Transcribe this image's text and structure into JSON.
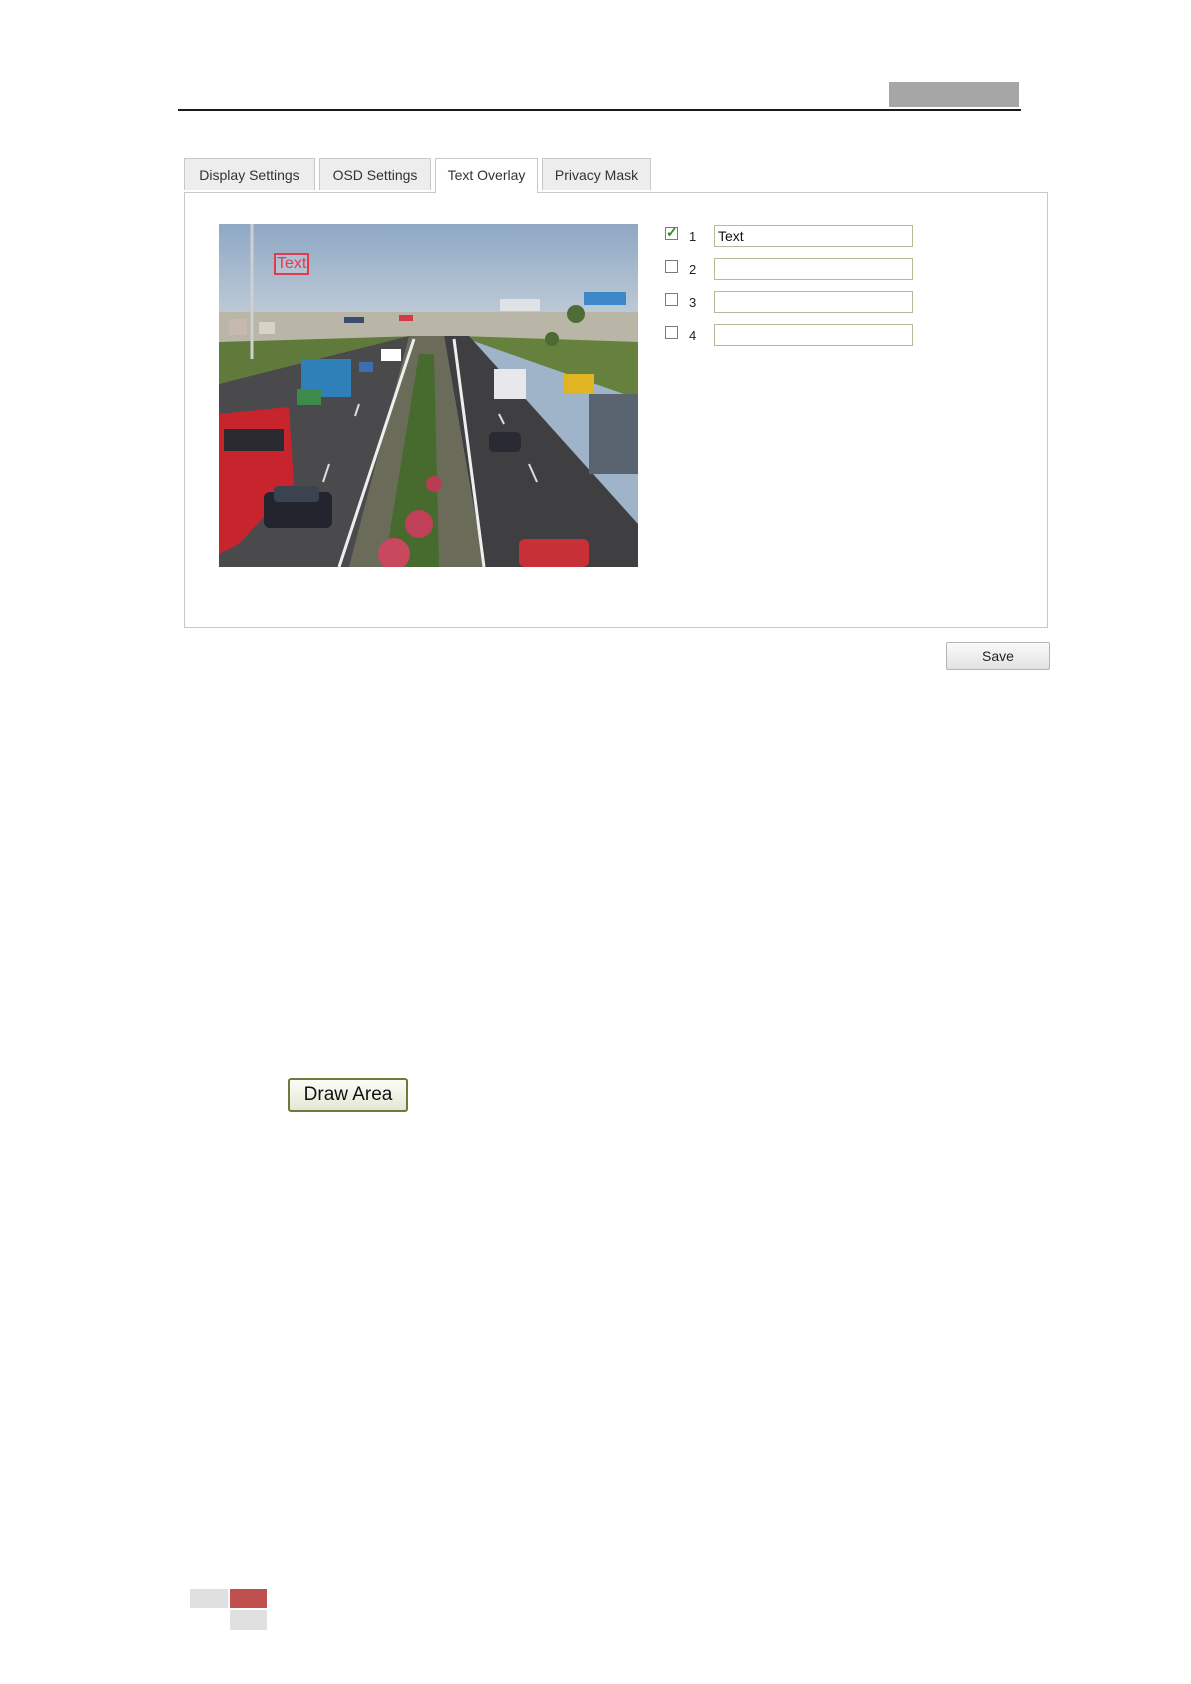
{
  "tabs": [
    {
      "label": "Display Settings"
    },
    {
      "label": "OSD Settings"
    },
    {
      "label": "Text Overlay",
      "active": true
    },
    {
      "label": "Privacy Mask"
    }
  ],
  "preview": {
    "overlay_text": "Text",
    "overlay_color": "#e23b4e"
  },
  "overlay_rows": [
    {
      "num": "1",
      "checked": true,
      "value": "Text"
    },
    {
      "num": "2",
      "checked": false,
      "value": ""
    },
    {
      "num": "3",
      "checked": false,
      "value": ""
    },
    {
      "num": "4",
      "checked": false,
      "value": ""
    }
  ],
  "save_label": "Save",
  "draw_area_label": "Draw Area",
  "colors": {
    "footer_accent": "#c0504d",
    "header_box": "#a6a6a6"
  }
}
